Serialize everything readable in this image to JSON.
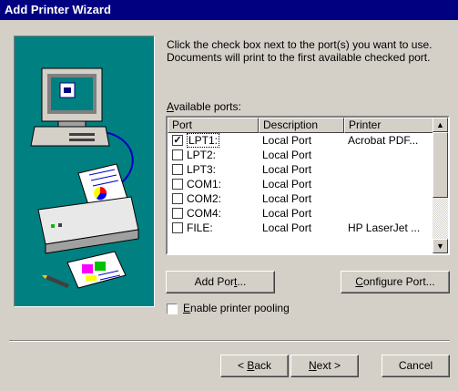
{
  "window": {
    "title": "Add Printer Wizard"
  },
  "instructions": {
    "line1": "Click the check box next to the port(s) you want to use.",
    "line2": "Documents will print to the first available checked port."
  },
  "ports_label": {
    "accel": "A",
    "rest": "vailable ports:"
  },
  "table": {
    "headers": {
      "port": "Port",
      "description": "Description",
      "printer": "Printer"
    },
    "rows": [
      {
        "checked": true,
        "port": "LPT1:",
        "description": "Local Port",
        "printer": "Acrobat PDF..."
      },
      {
        "checked": false,
        "port": "LPT2:",
        "description": "Local Port",
        "printer": ""
      },
      {
        "checked": false,
        "port": "LPT3:",
        "description": "Local Port",
        "printer": ""
      },
      {
        "checked": false,
        "port": "COM1:",
        "description": "Local Port",
        "printer": ""
      },
      {
        "checked": false,
        "port": "COM2:",
        "description": "Local Port",
        "printer": ""
      },
      {
        "checked": false,
        "port": "COM4:",
        "description": "Local Port",
        "printer": ""
      },
      {
        "checked": false,
        "port": "FILE:",
        "description": "Local Port",
        "printer": "HP LaserJet ..."
      }
    ]
  },
  "buttons": {
    "add_port": {
      "pre": "Add Por",
      "accel": "t",
      "post": "..."
    },
    "configure_port": {
      "pre": "",
      "accel": "C",
      "post": "onfigure Port..."
    },
    "back": {
      "pre": "< ",
      "accel": "B",
      "post": "ack"
    },
    "next": {
      "pre": "",
      "accel": "N",
      "post": "ext >"
    },
    "cancel": {
      "pre": "Cancel",
      "accel": "",
      "post": ""
    }
  },
  "pooling": {
    "checked": false,
    "accel": "E",
    "rest": "nable printer pooling"
  },
  "colors": {
    "titlebar": "#000080",
    "art_background": "#008080",
    "face": "#d4d0c8"
  }
}
